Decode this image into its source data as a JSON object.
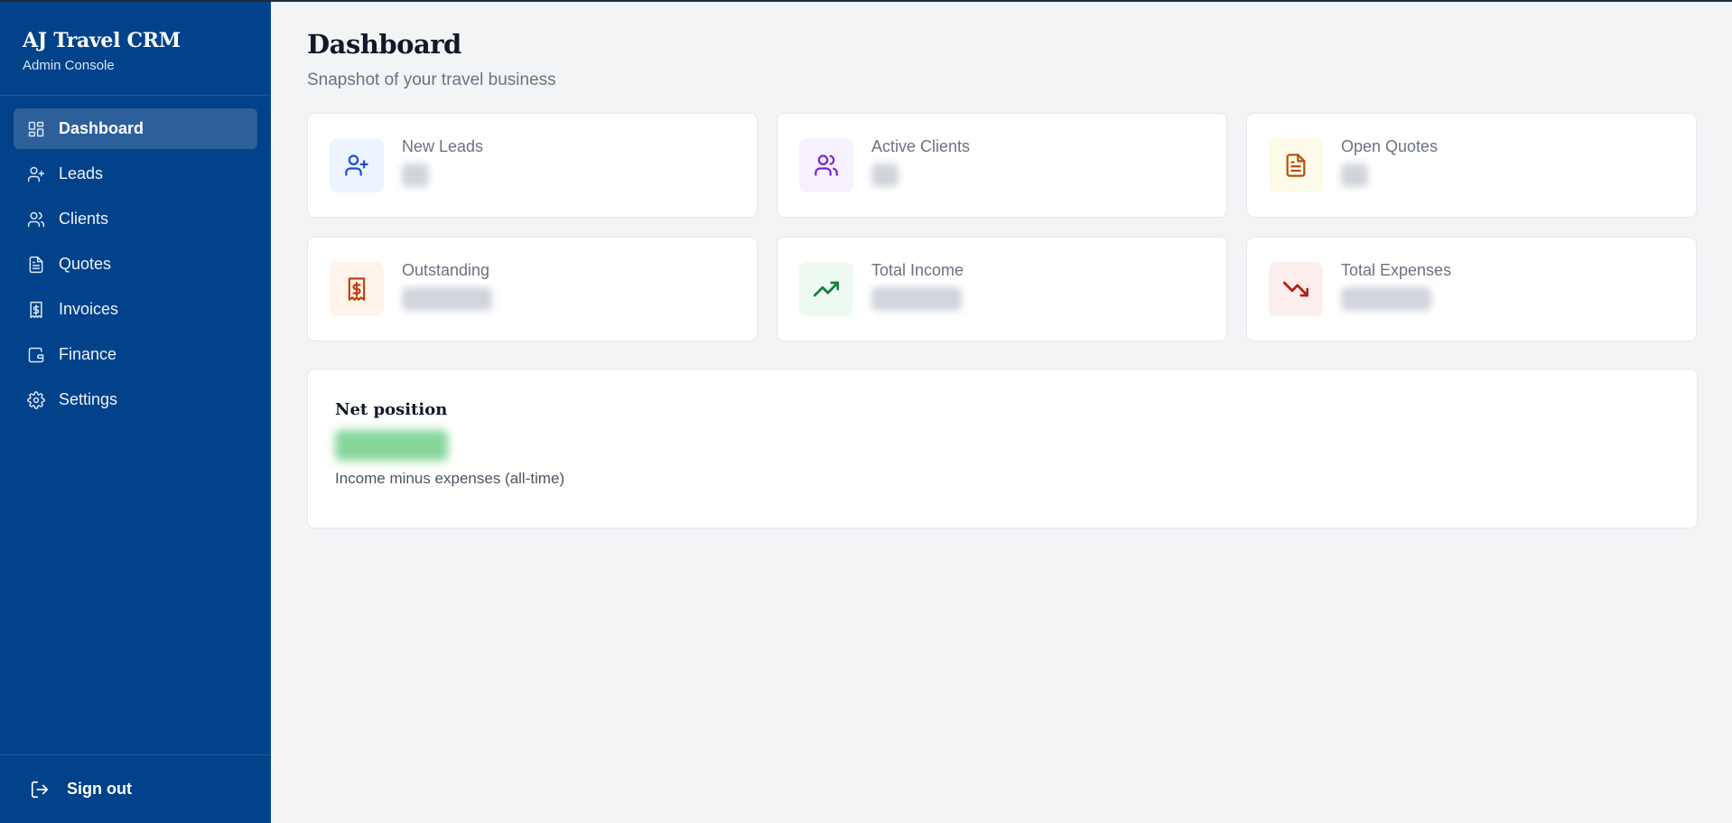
{
  "brand": {
    "title": "AJ Travel CRM",
    "subtitle": "Admin Console"
  },
  "nav": [
    {
      "label": "Dashboard",
      "icon": "dashboard-icon",
      "active": true
    },
    {
      "label": "Leads",
      "icon": "user-plus-icon"
    },
    {
      "label": "Clients",
      "icon": "users-icon"
    },
    {
      "label": "Quotes",
      "icon": "file-text-icon"
    },
    {
      "label": "Invoices",
      "icon": "receipt-icon"
    },
    {
      "label": "Finance",
      "icon": "wallet-icon"
    },
    {
      "label": "Settings",
      "icon": "gear-icon"
    }
  ],
  "signout": {
    "label": "Sign out",
    "icon": "log-out-icon"
  },
  "page": {
    "title": "Dashboard",
    "subtitle": "Snapshot of your travel business"
  },
  "stats": [
    {
      "label": "New Leads",
      "icon": "user-plus-icon",
      "color": "#1d4ed8",
      "bg": "#eef4ff"
    },
    {
      "label": "Active Clients",
      "icon": "users-icon",
      "color": "#7e22ce",
      "bg": "#f8f1ff"
    },
    {
      "label": "Open Quotes",
      "icon": "file-text-icon",
      "color": "#b45309",
      "bg": "#fffbea"
    },
    {
      "label": "Outstanding",
      "icon": "receipt-icon",
      "color": "#c2410c",
      "bg": "#fff4ec"
    },
    {
      "label": "Total Income",
      "icon": "trending-up-icon",
      "color": "#15803d",
      "bg": "#eefaf1"
    },
    {
      "label": "Total Expenses",
      "icon": "trending-down-icon",
      "color": "#b91c1c",
      "bg": "#fdeeee"
    }
  ],
  "net": {
    "title": "Net position",
    "subtitle": "Income minus expenses (all-time)"
  }
}
